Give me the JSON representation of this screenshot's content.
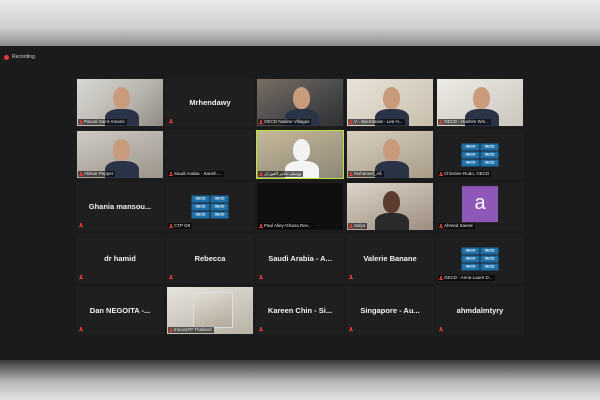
{
  "recording": {
    "label": "Recording"
  },
  "participants": [
    {
      "type": "video",
      "name": "Pascal Saint-Amans",
      "bg": "v-office"
    },
    {
      "type": "name",
      "name": "Mrhendawy"
    },
    {
      "type": "video",
      "name": "OECD Nadine Villagas",
      "bg": "v-room"
    },
    {
      "type": "video",
      "name": "V - Secretariat - Lee H...",
      "bg": "v-home"
    },
    {
      "type": "video",
      "name": "OECD - Hashim Win...",
      "bg": "v-light"
    },
    {
      "type": "video",
      "name": "Alistair Pepper",
      "bg": "v-gray"
    },
    {
      "type": "name",
      "name": "",
      "tag": "Saudi Arabia - Saneh ..."
    },
    {
      "type": "video",
      "name": "يوسف عامر الفوزان",
      "bg": "v-sheik",
      "active": true
    },
    {
      "type": "video",
      "name": "Mohamed_Ali",
      "bg": "v-beige"
    },
    {
      "type": "oecd",
      "name": "Christine Rudo, OECD"
    },
    {
      "type": "name",
      "name": "Ghania mansou..."
    },
    {
      "type": "oecd",
      "name": "CTP G9"
    },
    {
      "type": "video",
      "name": "Paul Aliey-Ghana Rev...",
      "bg": "v-dark"
    },
    {
      "type": "video",
      "name": "Salya",
      "bg": "v-woman"
    },
    {
      "type": "avatar",
      "letter": "a",
      "name": "Ahmed Saeed"
    },
    {
      "type": "name",
      "name": "dr hamid"
    },
    {
      "type": "name",
      "name": "Rebecca"
    },
    {
      "type": "name",
      "name": "Saudi Arabia - A..."
    },
    {
      "type": "name",
      "name": "Valerie Banane"
    },
    {
      "type": "oecd",
      "name": "OECD - Anne-Laure D..."
    },
    {
      "type": "name",
      "name": "Dan NEGOITA -..."
    },
    {
      "type": "photo",
      "name": "InnovaTP Thailand"
    },
    {
      "type": "name",
      "name": "Kareen Chin - Si..."
    },
    {
      "type": "name",
      "name": "Singapore - Au..."
    },
    {
      "type": "name",
      "name": "ahmdalmtyry"
    }
  ],
  "oecd_label": "OECD",
  "colors": {
    "active_border": "#b7e33c",
    "muted_mic": "#e53b3b",
    "avatar": "#8e58b8",
    "oecd_blue": "#1e6fa8"
  }
}
